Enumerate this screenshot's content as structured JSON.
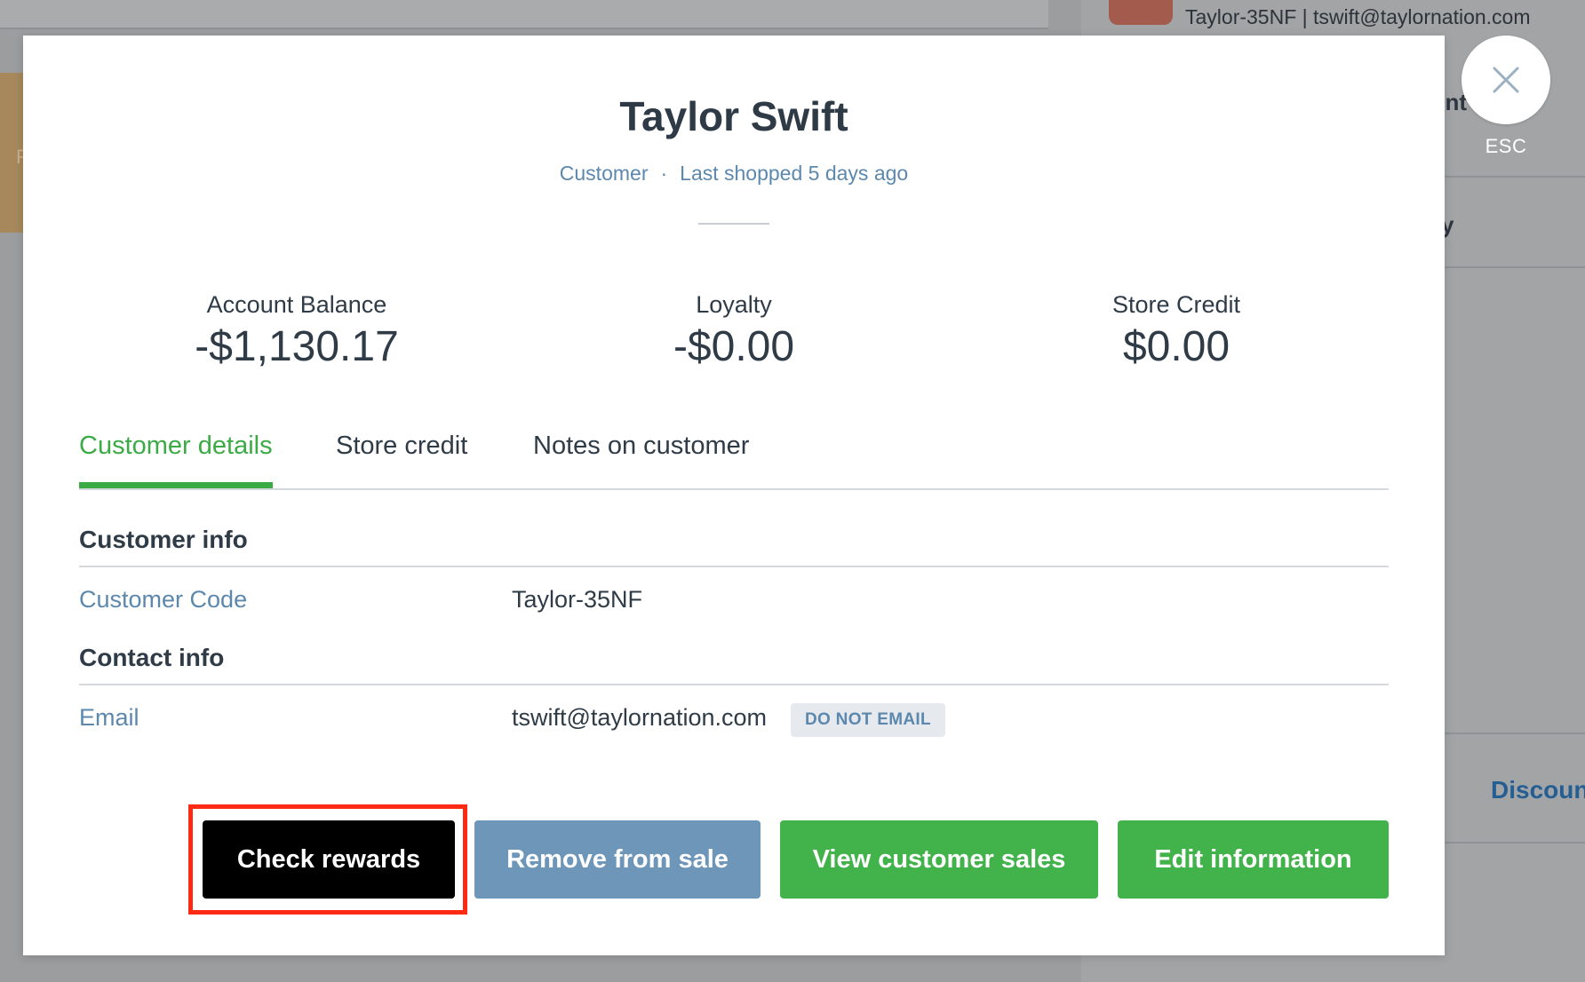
{
  "background": {
    "user_line": "Taylor-35NF | tswift@taylornation.com",
    "right_text_1": "ent",
    "right_text_2": "y",
    "discount_label": "Discoun",
    "orange_char": "F"
  },
  "close": {
    "icon": "close-icon",
    "esc_label": "ESC"
  },
  "customer": {
    "name": "Taylor Swift",
    "role": "Customer",
    "separator": "·",
    "last_shopped": "Last shopped 5 days ago"
  },
  "stats": [
    {
      "label": "Account Balance",
      "value": "-$1,130.17"
    },
    {
      "label": "Loyalty",
      "value": "-$0.00"
    },
    {
      "label": "Store Credit",
      "value": "$0.00"
    }
  ],
  "tabs": [
    {
      "label": "Customer details",
      "active": true
    },
    {
      "label": "Store credit",
      "active": false
    },
    {
      "label": "Notes on customer",
      "active": false
    }
  ],
  "customer_info": {
    "title": "Customer info",
    "code_label": "Customer Code",
    "code_value": "Taylor-35NF"
  },
  "contact_info": {
    "title": "Contact info",
    "email_label": "Email",
    "email_value": "tswift@taylornation.com",
    "badge": "DO NOT EMAIL"
  },
  "actions": {
    "check_rewards": "Check rewards",
    "remove_from_sale": "Remove from sale",
    "view_customer_sales": "View customer sales",
    "edit_information": "Edit information"
  },
  "colors": {
    "accent_green": "#42b24b",
    "link_blue": "#5d88ad",
    "highlight_red": "#ff2a14"
  }
}
